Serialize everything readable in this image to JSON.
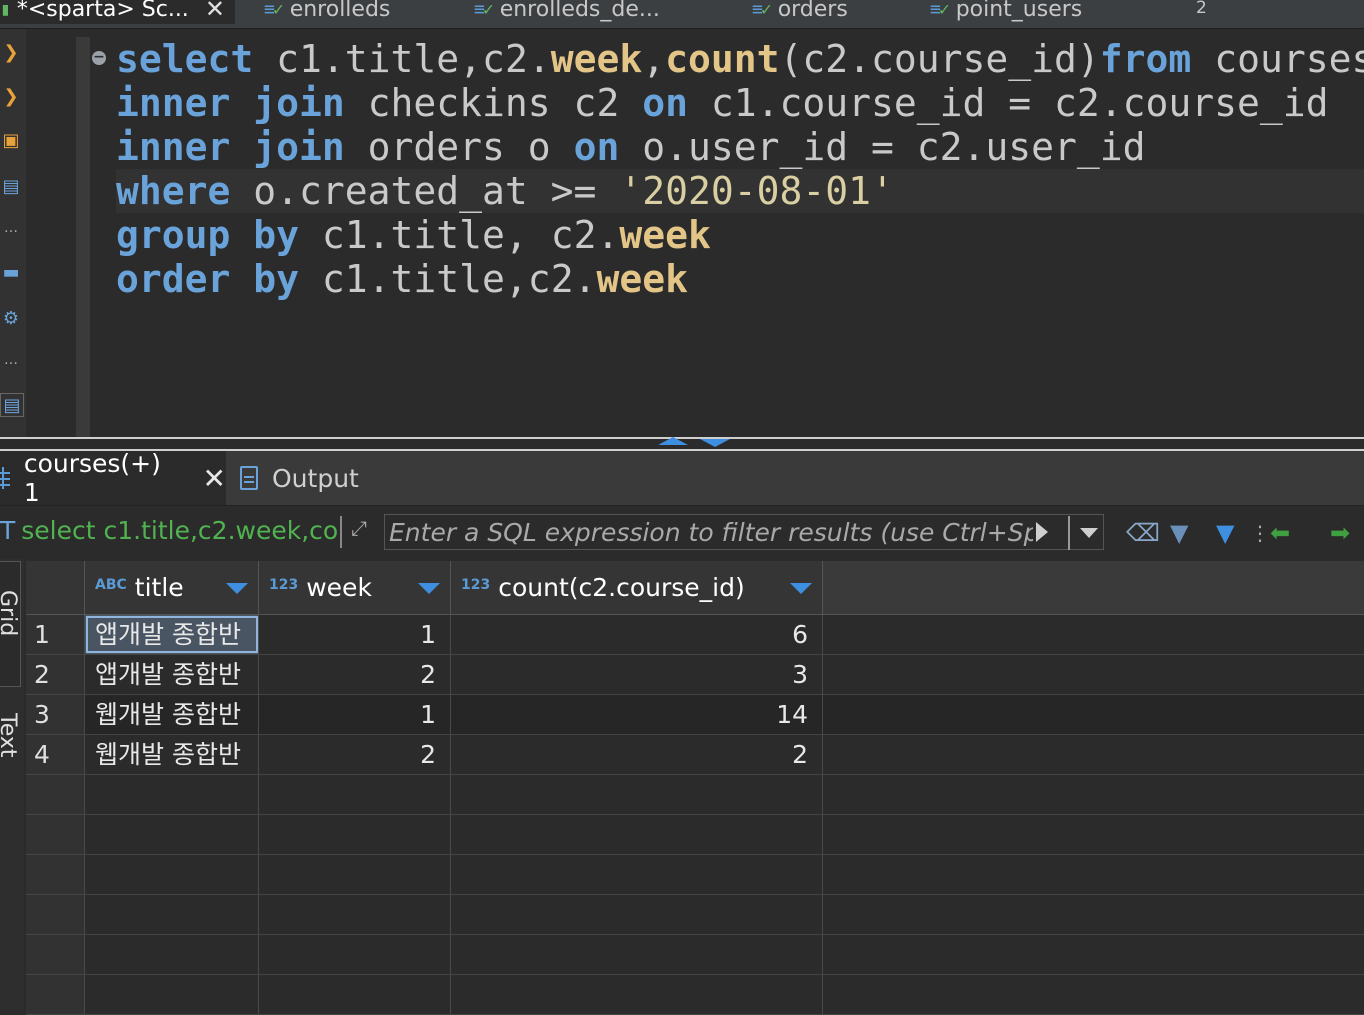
{
  "editor_tabs": [
    {
      "label": "*<sparta> Sc...",
      "close": "✕",
      "active": true
    },
    {
      "label": "enrolleds"
    },
    {
      "label": "enrolleds_de..."
    },
    {
      "label": "orders"
    },
    {
      "label": "point_users"
    }
  ],
  "editor_tabs_overflow": "2",
  "sql_lines": [
    [
      [
        "kw",
        "select"
      ],
      [
        "tx",
        " c1.title,c2."
      ],
      [
        "fn",
        "week"
      ],
      [
        "tx",
        ","
      ],
      [
        "fn",
        "count"
      ],
      [
        "tx",
        "(c2.course_id)"
      ],
      [
        "kw",
        "from"
      ],
      [
        "tx",
        " courses"
      ]
    ],
    [
      [
        "kw",
        "inner join"
      ],
      [
        "tx",
        " checkins c2 "
      ],
      [
        "kw",
        "on"
      ],
      [
        "tx",
        " c1.course_id = c2.course_id"
      ]
    ],
    [
      [
        "kw",
        "inner join"
      ],
      [
        "tx",
        " orders o "
      ],
      [
        "kw",
        "on"
      ],
      [
        "tx",
        " o.user_id = c2.user_id"
      ]
    ],
    [
      [
        "kw",
        "where"
      ],
      [
        "tx",
        " o.created_at >= "
      ],
      [
        "str",
        "'2020-08-01'"
      ]
    ],
    [
      [
        "kw",
        "group by"
      ],
      [
        "tx",
        " c1.title, c2."
      ],
      [
        "fn",
        "week"
      ]
    ],
    [
      [
        "kw",
        "order by"
      ],
      [
        "tx",
        " c1.title,c2."
      ],
      [
        "fn",
        "week"
      ]
    ]
  ],
  "result_tabs": {
    "courses_label": "courses(+) 1",
    "output_label": "Output"
  },
  "filter": {
    "query_preview": "select c1.title,c2.week,co",
    "placeholder": "Enter a SQL expression to filter results (use Ctrl+Space)"
  },
  "side_tabs": {
    "grid": "Grid",
    "text": "Text"
  },
  "grid": {
    "columns": [
      {
        "type_icon": "ABC",
        "name": "title"
      },
      {
        "type_icon": "123",
        "name": "week"
      },
      {
        "type_icon": "123",
        "name": "count(c2.course_id)"
      }
    ],
    "rows": [
      {
        "n": "1",
        "title": "앱개발 종합반",
        "week": "1",
        "count": "6"
      },
      {
        "n": "2",
        "title": "앱개발 종합반",
        "week": "2",
        "count": "3"
      },
      {
        "n": "3",
        "title": "웹개발 종합반",
        "week": "1",
        "count": "14"
      },
      {
        "n": "4",
        "title": "웹개발 종합반",
        "week": "2",
        "count": "2"
      }
    ]
  },
  "colors": {
    "keyword": "#6aa3da",
    "function": "#e3c588",
    "string": "#d9cfa3",
    "accent": "#3f8fe0"
  }
}
